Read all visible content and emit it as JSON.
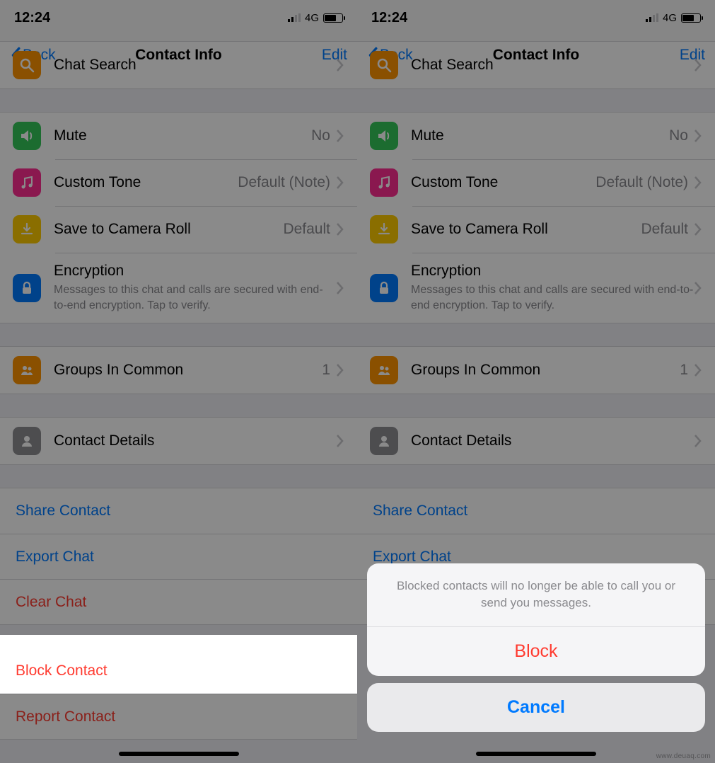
{
  "status": {
    "time": "12:24",
    "network": "4G"
  },
  "nav": {
    "back": "Back",
    "title": "Contact Info",
    "edit": "Edit"
  },
  "rows": {
    "chat_search": "Chat Search",
    "mute": "Mute",
    "mute_value": "No",
    "custom_tone": "Custom Tone",
    "custom_tone_value": "Default (Note)",
    "save_roll": "Save to Camera Roll",
    "save_roll_value": "Default",
    "encryption": "Encryption",
    "encryption_sub": "Messages to this chat and calls are secured with end-to-end encryption. Tap to verify.",
    "groups": "Groups In Common",
    "groups_value": "1",
    "contact_details": "Contact Details"
  },
  "actions": {
    "share": "Share Contact",
    "export": "Export Chat",
    "clear": "Clear Chat",
    "block": "Block Contact",
    "report": "Report Contact"
  },
  "sheet": {
    "message": "Blocked contacts will no longer be able to call you or send you messages.",
    "block": "Block",
    "cancel": "Cancel"
  },
  "colors": {
    "blue": "#007aff",
    "red": "#ff3b30",
    "orange": "#ff9500",
    "green": "#34c759",
    "pink": "#ff2d92",
    "yellow": "#ffcc00",
    "gray": "#8e8e93"
  },
  "watermark": "www.deuaq.com"
}
